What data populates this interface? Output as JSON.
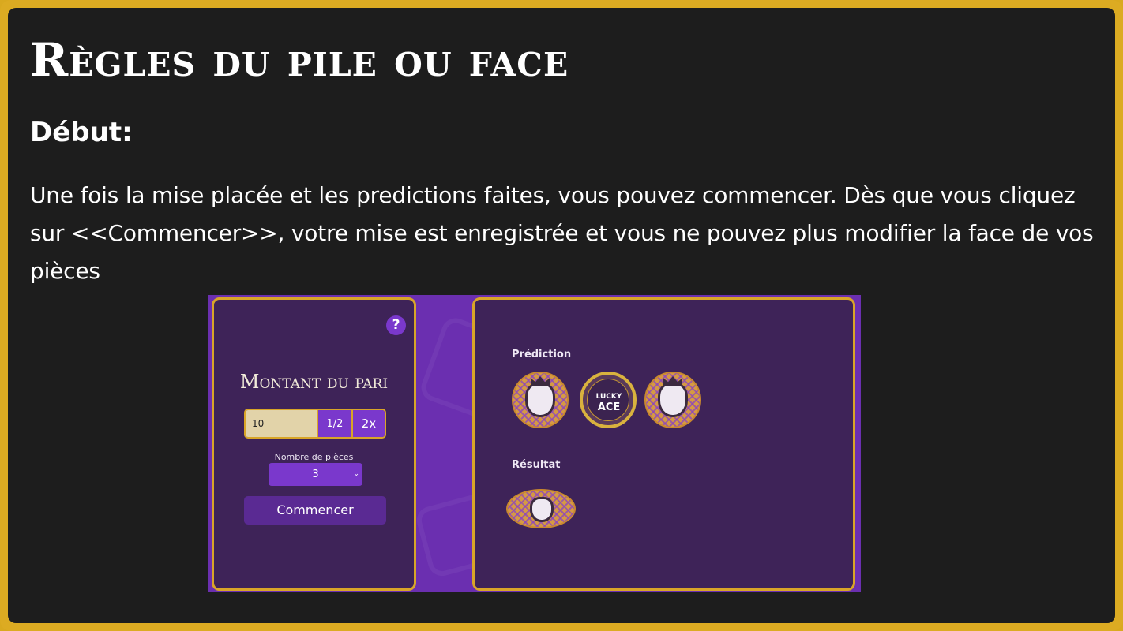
{
  "page": {
    "title": "Règles du pile ou face",
    "subtitle": "Début:",
    "paragraph": "Une fois la mise placée et les predictions faites, vous pouvez commencer. Dès que vous cliquez sur <<Commencer>>, votre mise est enregistrée et vous ne pouvez plus modifier la face de vos pièces"
  },
  "colors": {
    "frame": "#dcab22",
    "background": "#1d1d1d",
    "card": "#3e2358",
    "accent_purple": "#7a38cc",
    "accent_gold": "#d9a528"
  },
  "screenshot": {
    "help_label": "?",
    "bet_heading": "Montant du pari",
    "bet_value": "10",
    "half_label": "1/2",
    "double_label": "2x",
    "coins_label": "Nombre de pièces",
    "coins_value": "3",
    "start_label": "Commencer",
    "prediction_label": "Prédiction",
    "result_label": "Résultat",
    "ace_lucky": "LUCKY",
    "ace_word": "ACE",
    "prediction_coins": [
      "lion-face-icon",
      "lucky-ace-icon",
      "lion-face-icon"
    ],
    "result_coin": "lion-face-icon"
  }
}
